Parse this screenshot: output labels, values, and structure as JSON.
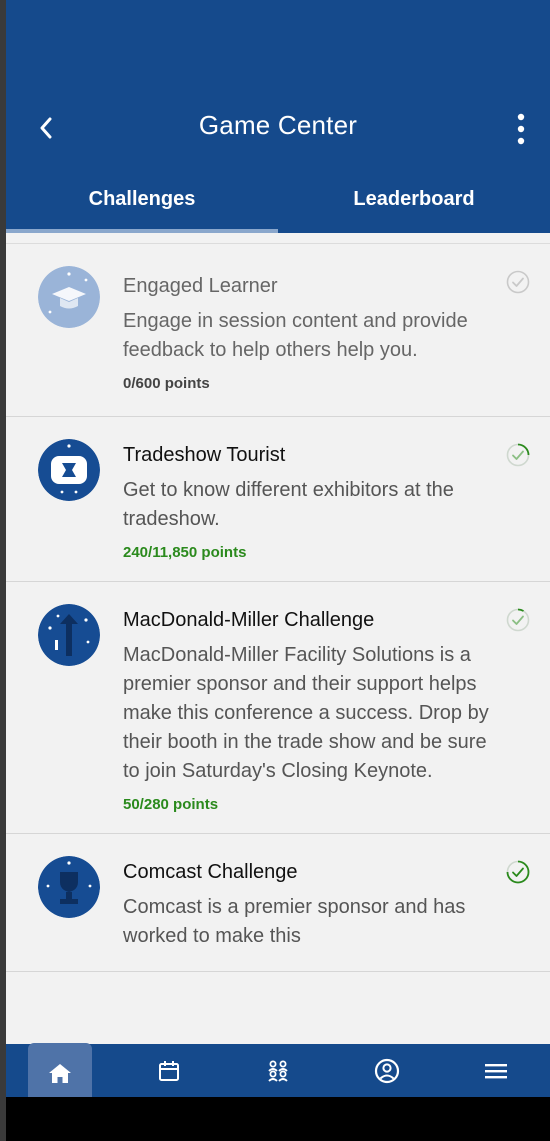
{
  "header": {
    "title": "Game Center"
  },
  "tabs": [
    {
      "label": "Challenges",
      "active": true
    },
    {
      "label": "Leaderboard",
      "active": false
    }
  ],
  "challenges": [
    {
      "title": "Engaged Learner",
      "description": "Engage in session content and provide feedback to help others help you.",
      "points": "0/600 points",
      "icon": "mortarboard-badge-icon",
      "state": "disabled"
    },
    {
      "title": "Tradeshow Tourist",
      "description": "Get to know different exhibitors at the tradeshow.",
      "points": "240/11,850 points",
      "icon": "tradeshow-booth-badge-icon",
      "state": "in-progress"
    },
    {
      "title": "MacDonald-Miller Challenge",
      "description": "MacDonald-Miller Facility Solutions is a premier sponsor and their support helps make this conference a success. Drop by their booth in the trade show and be sure to join Saturday's Closing Keynote.",
      "points": "50/280 points",
      "icon": "sponsor-badge-icon",
      "state": "in-progress"
    },
    {
      "title": "Comcast Challenge",
      "description": "Comcast is a premier sponsor and has worked to make this",
      "points": "",
      "icon": "trophy-badge-icon",
      "state": "in-progress"
    }
  ],
  "bottom_nav": [
    {
      "icon": "home-icon",
      "active": true
    },
    {
      "icon": "calendar-icon",
      "active": false
    },
    {
      "icon": "people-icon",
      "active": false
    },
    {
      "icon": "profile-icon",
      "active": false
    },
    {
      "icon": "menu-icon",
      "active": false
    }
  ],
  "colors": {
    "primary": "#154a8c",
    "progress_green": "#2b8a1d",
    "background": "#f2f2f2",
    "tab_indicator": "#8aa7cc"
  }
}
